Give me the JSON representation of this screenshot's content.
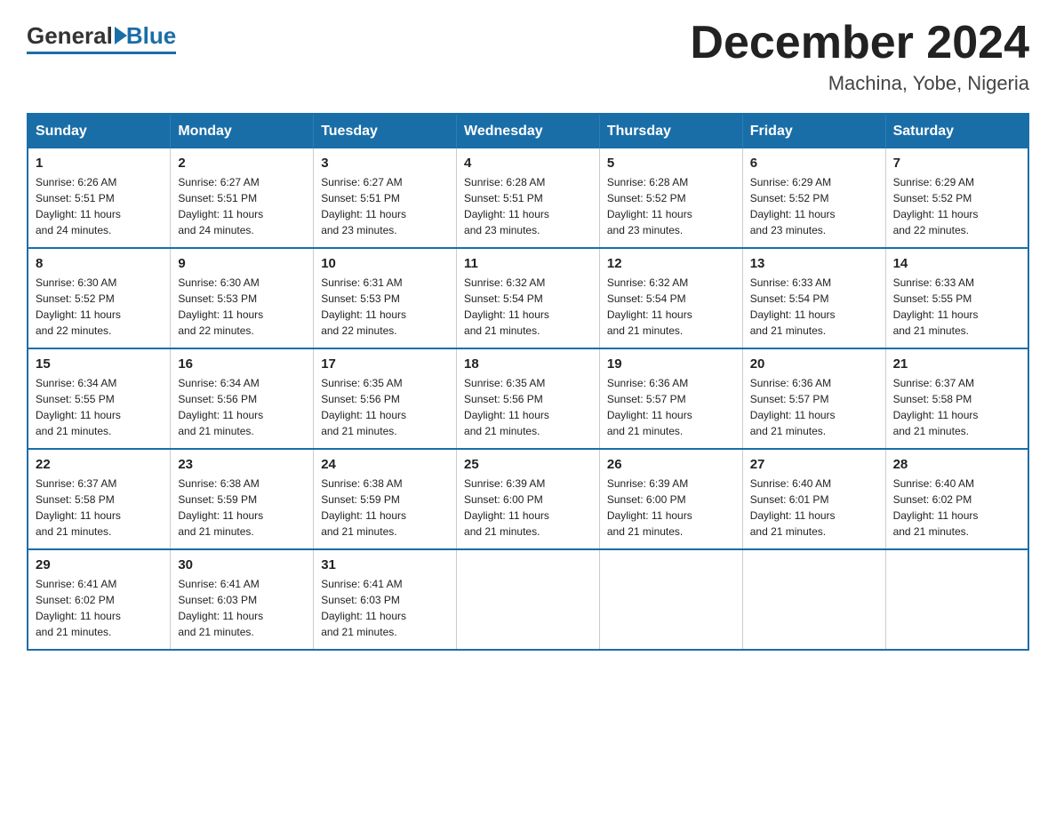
{
  "logo": {
    "general": "General",
    "blue": "Blue"
  },
  "title": {
    "month_year": "December 2024",
    "location": "Machina, Yobe, Nigeria"
  },
  "days_of_week": [
    "Sunday",
    "Monday",
    "Tuesday",
    "Wednesday",
    "Thursday",
    "Friday",
    "Saturday"
  ],
  "weeks": [
    [
      {
        "day": "1",
        "sunrise": "6:26 AM",
        "sunset": "5:51 PM",
        "daylight": "11 hours and 24 minutes."
      },
      {
        "day": "2",
        "sunrise": "6:27 AM",
        "sunset": "5:51 PM",
        "daylight": "11 hours and 24 minutes."
      },
      {
        "day": "3",
        "sunrise": "6:27 AM",
        "sunset": "5:51 PM",
        "daylight": "11 hours and 23 minutes."
      },
      {
        "day": "4",
        "sunrise": "6:28 AM",
        "sunset": "5:51 PM",
        "daylight": "11 hours and 23 minutes."
      },
      {
        "day": "5",
        "sunrise": "6:28 AM",
        "sunset": "5:52 PM",
        "daylight": "11 hours and 23 minutes."
      },
      {
        "day": "6",
        "sunrise": "6:29 AM",
        "sunset": "5:52 PM",
        "daylight": "11 hours and 23 minutes."
      },
      {
        "day": "7",
        "sunrise": "6:29 AM",
        "sunset": "5:52 PM",
        "daylight": "11 hours and 22 minutes."
      }
    ],
    [
      {
        "day": "8",
        "sunrise": "6:30 AM",
        "sunset": "5:52 PM",
        "daylight": "11 hours and 22 minutes."
      },
      {
        "day": "9",
        "sunrise": "6:30 AM",
        "sunset": "5:53 PM",
        "daylight": "11 hours and 22 minutes."
      },
      {
        "day": "10",
        "sunrise": "6:31 AM",
        "sunset": "5:53 PM",
        "daylight": "11 hours and 22 minutes."
      },
      {
        "day": "11",
        "sunrise": "6:32 AM",
        "sunset": "5:54 PM",
        "daylight": "11 hours and 21 minutes."
      },
      {
        "day": "12",
        "sunrise": "6:32 AM",
        "sunset": "5:54 PM",
        "daylight": "11 hours and 21 minutes."
      },
      {
        "day": "13",
        "sunrise": "6:33 AM",
        "sunset": "5:54 PM",
        "daylight": "11 hours and 21 minutes."
      },
      {
        "day": "14",
        "sunrise": "6:33 AM",
        "sunset": "5:55 PM",
        "daylight": "11 hours and 21 minutes."
      }
    ],
    [
      {
        "day": "15",
        "sunrise": "6:34 AM",
        "sunset": "5:55 PM",
        "daylight": "11 hours and 21 minutes."
      },
      {
        "day": "16",
        "sunrise": "6:34 AM",
        "sunset": "5:56 PM",
        "daylight": "11 hours and 21 minutes."
      },
      {
        "day": "17",
        "sunrise": "6:35 AM",
        "sunset": "5:56 PM",
        "daylight": "11 hours and 21 minutes."
      },
      {
        "day": "18",
        "sunrise": "6:35 AM",
        "sunset": "5:56 PM",
        "daylight": "11 hours and 21 minutes."
      },
      {
        "day": "19",
        "sunrise": "6:36 AM",
        "sunset": "5:57 PM",
        "daylight": "11 hours and 21 minutes."
      },
      {
        "day": "20",
        "sunrise": "6:36 AM",
        "sunset": "5:57 PM",
        "daylight": "11 hours and 21 minutes."
      },
      {
        "day": "21",
        "sunrise": "6:37 AM",
        "sunset": "5:58 PM",
        "daylight": "11 hours and 21 minutes."
      }
    ],
    [
      {
        "day": "22",
        "sunrise": "6:37 AM",
        "sunset": "5:58 PM",
        "daylight": "11 hours and 21 minutes."
      },
      {
        "day": "23",
        "sunrise": "6:38 AM",
        "sunset": "5:59 PM",
        "daylight": "11 hours and 21 minutes."
      },
      {
        "day": "24",
        "sunrise": "6:38 AM",
        "sunset": "5:59 PM",
        "daylight": "11 hours and 21 minutes."
      },
      {
        "day": "25",
        "sunrise": "6:39 AM",
        "sunset": "6:00 PM",
        "daylight": "11 hours and 21 minutes."
      },
      {
        "day": "26",
        "sunrise": "6:39 AM",
        "sunset": "6:00 PM",
        "daylight": "11 hours and 21 minutes."
      },
      {
        "day": "27",
        "sunrise": "6:40 AM",
        "sunset": "6:01 PM",
        "daylight": "11 hours and 21 minutes."
      },
      {
        "day": "28",
        "sunrise": "6:40 AM",
        "sunset": "6:02 PM",
        "daylight": "11 hours and 21 minutes."
      }
    ],
    [
      {
        "day": "29",
        "sunrise": "6:41 AM",
        "sunset": "6:02 PM",
        "daylight": "11 hours and 21 minutes."
      },
      {
        "day": "30",
        "sunrise": "6:41 AM",
        "sunset": "6:03 PM",
        "daylight": "11 hours and 21 minutes."
      },
      {
        "day": "31",
        "sunrise": "6:41 AM",
        "sunset": "6:03 PM",
        "daylight": "11 hours and 21 minutes."
      },
      null,
      null,
      null,
      null
    ]
  ],
  "labels": {
    "sunrise": "Sunrise:",
    "sunset": "Sunset:",
    "daylight": "Daylight:"
  }
}
